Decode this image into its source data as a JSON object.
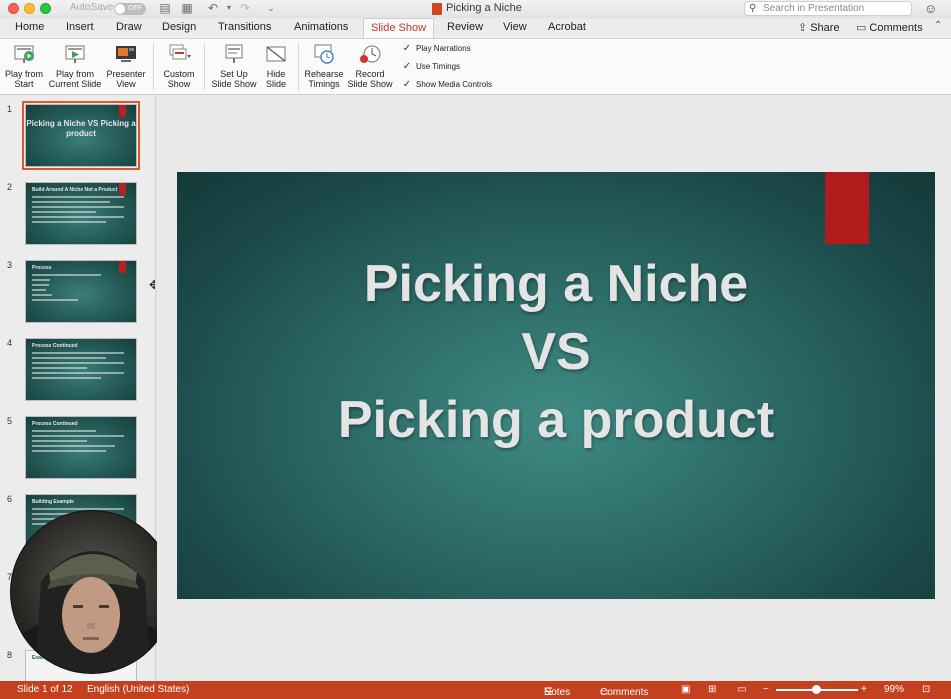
{
  "window": {
    "title": "Picking a Niche",
    "autosave_label": "AutoSave",
    "autosave_state": "OFF",
    "search_placeholder": "Search in Presentation"
  },
  "tabs": [
    "Home",
    "Insert",
    "Draw",
    "Design",
    "Transitions",
    "Animations",
    "Slide Show",
    "Review",
    "View",
    "Acrobat"
  ],
  "active_tab": "Slide Show",
  "header_actions": {
    "share": "Share",
    "comments": "Comments"
  },
  "ribbon": {
    "play_from_start": [
      "Play from",
      "Start"
    ],
    "play_from_current": [
      "Play from",
      "Current Slide"
    ],
    "presenter_view": [
      "Presenter",
      "View"
    ],
    "custom_show": [
      "Custom",
      "Show"
    ],
    "set_up_slide_show": [
      "Set Up",
      "Slide Show"
    ],
    "hide_slide": [
      "Hide",
      "Slide"
    ],
    "rehearse_timings": [
      "Rehearse",
      "Timings"
    ],
    "record_slide_show": [
      "Record",
      "Slide Show"
    ],
    "checkboxes": [
      {
        "label": "Play Narrations",
        "checked": true
      },
      {
        "label": "Use Timings",
        "checked": true
      },
      {
        "label": "Show Media Controls",
        "checked": true
      }
    ]
  },
  "thumbnails": [
    {
      "num": "1",
      "title": "Picking a Niche VS Picking a product",
      "selected": true
    },
    {
      "num": "2",
      "title": "Build Around A Niche Not a Product"
    },
    {
      "num": "3",
      "title": "Process"
    },
    {
      "num": "4",
      "title": "Process Continued"
    },
    {
      "num": "5",
      "title": "Process Continued"
    },
    {
      "num": "6",
      "title": "Building Example"
    },
    {
      "num": "7",
      "title": ""
    },
    {
      "num": "8",
      "title": "Exam"
    }
  ],
  "slide": {
    "line1": "Picking a Niche",
    "line2": "VS",
    "line3": "Picking a product"
  },
  "statusbar": {
    "slide_info": "Slide 1 of 12",
    "language": "English (United States)",
    "notes": "Notes",
    "comments": "Comments",
    "zoom": "99%"
  },
  "colors": {
    "accent": "#c4401f",
    "active_tab": "#c0392b",
    "slide_red_bar": "#b01c1c",
    "slide_bg": "#2a6662"
  }
}
